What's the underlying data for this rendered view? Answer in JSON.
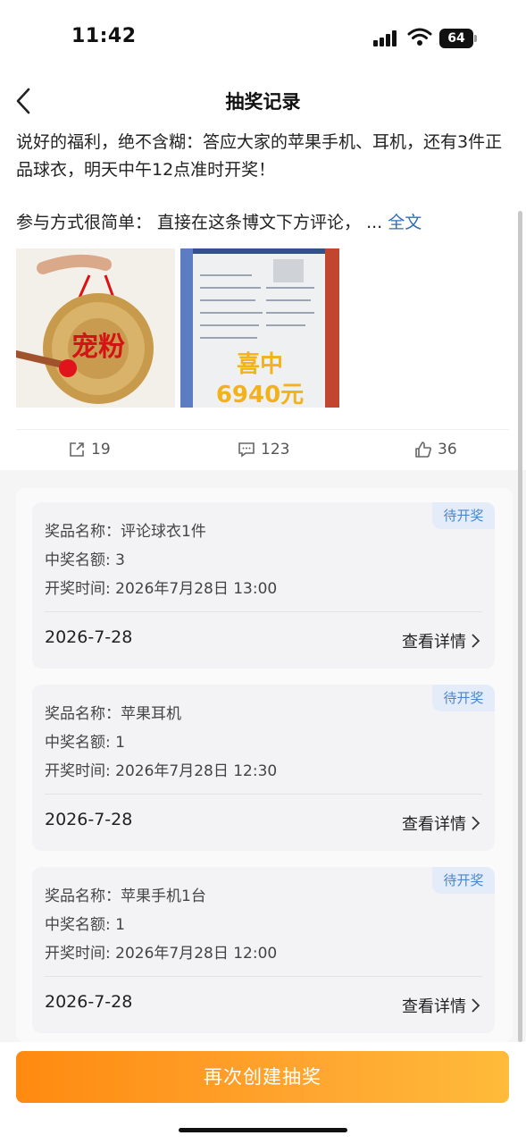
{
  "status_bar": {
    "time": "11:42",
    "battery": "64"
  },
  "nav": {
    "title": "抽奖记录"
  },
  "post": {
    "text_line1": "说好的福利，绝不含糊：答应大家的苹果手机、耳机，还有3件正品球衣，明天中午12点准时开奖！",
    "text_line2": "参与方式很简单： 直接在这条博文下方评论， ... ",
    "fulltext_link": "全文",
    "image1_caption": "宠粉",
    "image2_caption1": "喜中",
    "image2_caption2": "6940元"
  },
  "actions": {
    "share_count": "19",
    "comment_count": "123",
    "like_count": "36"
  },
  "lottery_cards": [
    {
      "status": "待开奖",
      "prize": "奖品名称：评论球衣1件",
      "winners": "中奖名额: 3",
      "draw_time": "开奖时间: 2026年7月28日 13:00",
      "date": "2026-7-28",
      "detail_label": "查看详情"
    },
    {
      "status": "待开奖",
      "prize": "奖品名称：苹果耳机",
      "winners": "中奖名额: 1",
      "draw_time": "开奖时间: 2026年7月28日 12:30",
      "date": "2026-7-28",
      "detail_label": "查看详情"
    },
    {
      "status": "待开奖",
      "prize": "奖品名称：苹果手机1台",
      "winners": "中奖名额: 1",
      "draw_time": "开奖时间: 2026年7月28日 12:00",
      "date": "2026-7-28",
      "detail_label": "查看详情"
    }
  ],
  "bottom": {
    "create_label": "再次创建抽奖"
  },
  "colors": {
    "accent_orange": "#ff8a10",
    "link_blue": "#2f6fba",
    "badge_blue": "#4a86d0"
  }
}
